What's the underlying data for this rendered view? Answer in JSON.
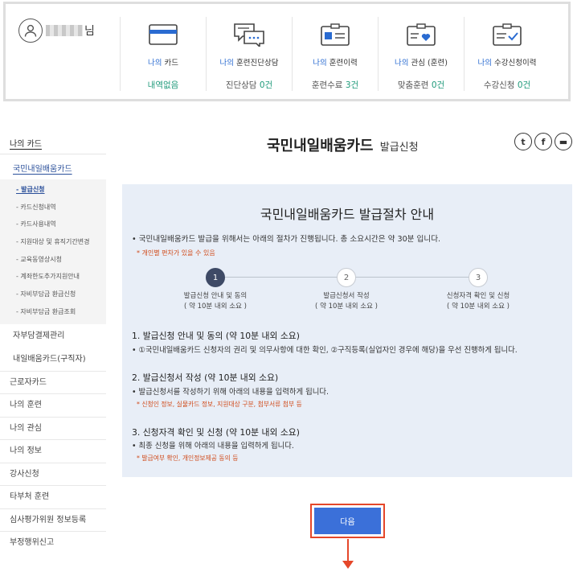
{
  "user": {
    "suffix": "님"
  },
  "stats": [
    {
      "pre": "나의",
      "label": " 카드",
      "value": "내역없음",
      "num": ""
    },
    {
      "pre": "나의",
      "label": " 훈련진단상담",
      "value": "진단상담 ",
      "num": "0건"
    },
    {
      "pre": "나의",
      "label": " 훈련이력",
      "value": "훈련수료 ",
      "num": "3건"
    },
    {
      "pre": "나의",
      "label": " 관심 (훈련)",
      "value": "맞춤훈련 ",
      "num": "0건"
    },
    {
      "pre": "나의",
      "label": " 수강신청이력",
      "value": "수강신청 ",
      "num": "0건"
    }
  ],
  "sidebar": {
    "top": "나의 카드",
    "sub": "국민내일배움카드",
    "children": [
      "- 발급신청",
      "- 카드신청내역",
      "- 카드사용내역",
      "- 지원대상 및 휴직기간변경",
      "- 교육동영상시청",
      "- 계좌한도추가지원안내",
      "- 자비부담금 환급신청",
      "- 자비부담금 환급조회"
    ],
    "sub_items": [
      "자부담결제관리",
      "내일배움카드(구직자)"
    ],
    "items": [
      "근로자카드",
      "나의 훈련",
      "나의 관심",
      "나의 정보",
      "강사신청",
      "타부처 훈련",
      "심사평가위원 정보등록",
      "부정행위신고"
    ]
  },
  "page": {
    "title": "국민내일배움카드",
    "subtitle": "발급신청"
  },
  "share": {
    "twitter": "t",
    "facebook": "f",
    "other": "▬"
  },
  "guide": {
    "heading": "국민내일배움카드 발급절차 안내",
    "intro": "• 국민내일배움카드 발급을 위해서는 아래의 절차가 진행됩니다. 총 소요시간은 약 30분 입니다.",
    "note": "* 개인별 편차가 있을 수 있음",
    "steps": [
      {
        "num": "1",
        "label": "발급신청 안내 및 동의",
        "time": "( 약 10분 내외 소요 )"
      },
      {
        "num": "2",
        "label": "발급신청서 작성",
        "time": "( 약 10분 내외 소요 )"
      },
      {
        "num": "3",
        "label": "신청자격 확인 및 신청",
        "time": "( 약 10분 내외 소요 )"
      }
    ],
    "sections": [
      {
        "heading": "1. 발급신청 안내 및 동의 (약 10분 내외 소요)",
        "text": "• ①국민내일배움카드 신청자의 권리 및 의무사항에 대한 확인, ②구직등록(실업자인 경우에 해당)을 우선 진행하게 됩니다.",
        "note": ""
      },
      {
        "heading": "2. 발급신청서 작성 (약 10분 내외 소요)",
        "text": "• 발급신청서를 작성하기 위해 아래의 내용을 입력하게 됩니다.",
        "note": "* 신청인 정보, 실물카드 정보, 지원대상 구분, 첨부서류 첨부 등"
      },
      {
        "heading": "3. 신청자격 확인 및 신청 (약 10분 내외 소요)",
        "text": "• 최종 신청을 위해 아래의 내용을 입력하게 됩니다.",
        "note": "* 발급여부 확인, 개인정보제공 동의 등"
      }
    ]
  },
  "next_button": {
    "label": "다음"
  },
  "colors": {
    "accent": "#3b70d9",
    "highlight": "#e5472a",
    "teal": "#1f9a7a",
    "panel": "#e8eef7"
  }
}
